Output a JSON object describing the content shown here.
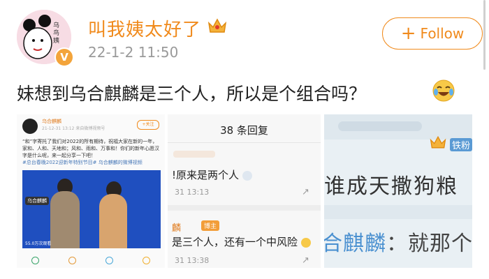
{
  "header": {
    "username": "叫我姨太好了",
    "timestamp": "22-1-2 11:50",
    "follow_plus": "+",
    "follow_label": "Follow",
    "avatar_text": "乌鸟姨",
    "verified_mark": "V",
    "crown_icon": "crown-icon"
  },
  "post": {
    "text": "妹想到乌合麒麟是三个人，所以是个组合吗？",
    "emoji": "laugh-cry-emoji"
  },
  "images": {
    "one": {
      "account_name": "乌合麒麟",
      "meta": "21-12-31 13:12  来自微博视频号",
      "follow": "+关注",
      "body": "“和”字寄托了我们对2022的所有期待，祝福大家在新的一年，家和、人和、天地和；风和、雨和、万事和！你们的新年心愿汉字是什么呢，来一起分享一下吧！",
      "tags": "#总台春晚2022迎新年特别节目# 乌合麒麟的微博视频",
      "video_label": "乌合麒麟",
      "view_count": "55.0万次观看"
    },
    "two": {
      "title": "38 条回复",
      "reply1": "!原来是两个人",
      "time1": "31 13:13",
      "reply2_name": "麟",
      "reply2_badge": "博主",
      "reply2": "是三个人，还有一个中风险",
      "time2": "31 13:38"
    },
    "three": {
      "fan_badge": "铁粉",
      "line1": "谁成天撒狗粮",
      "line2_name": "合麒麟",
      "line2_rest": "：就那个高"
    }
  },
  "colors": {
    "accent": "#f08a1c",
    "text": "#222222",
    "muted": "#9a9a9a"
  }
}
